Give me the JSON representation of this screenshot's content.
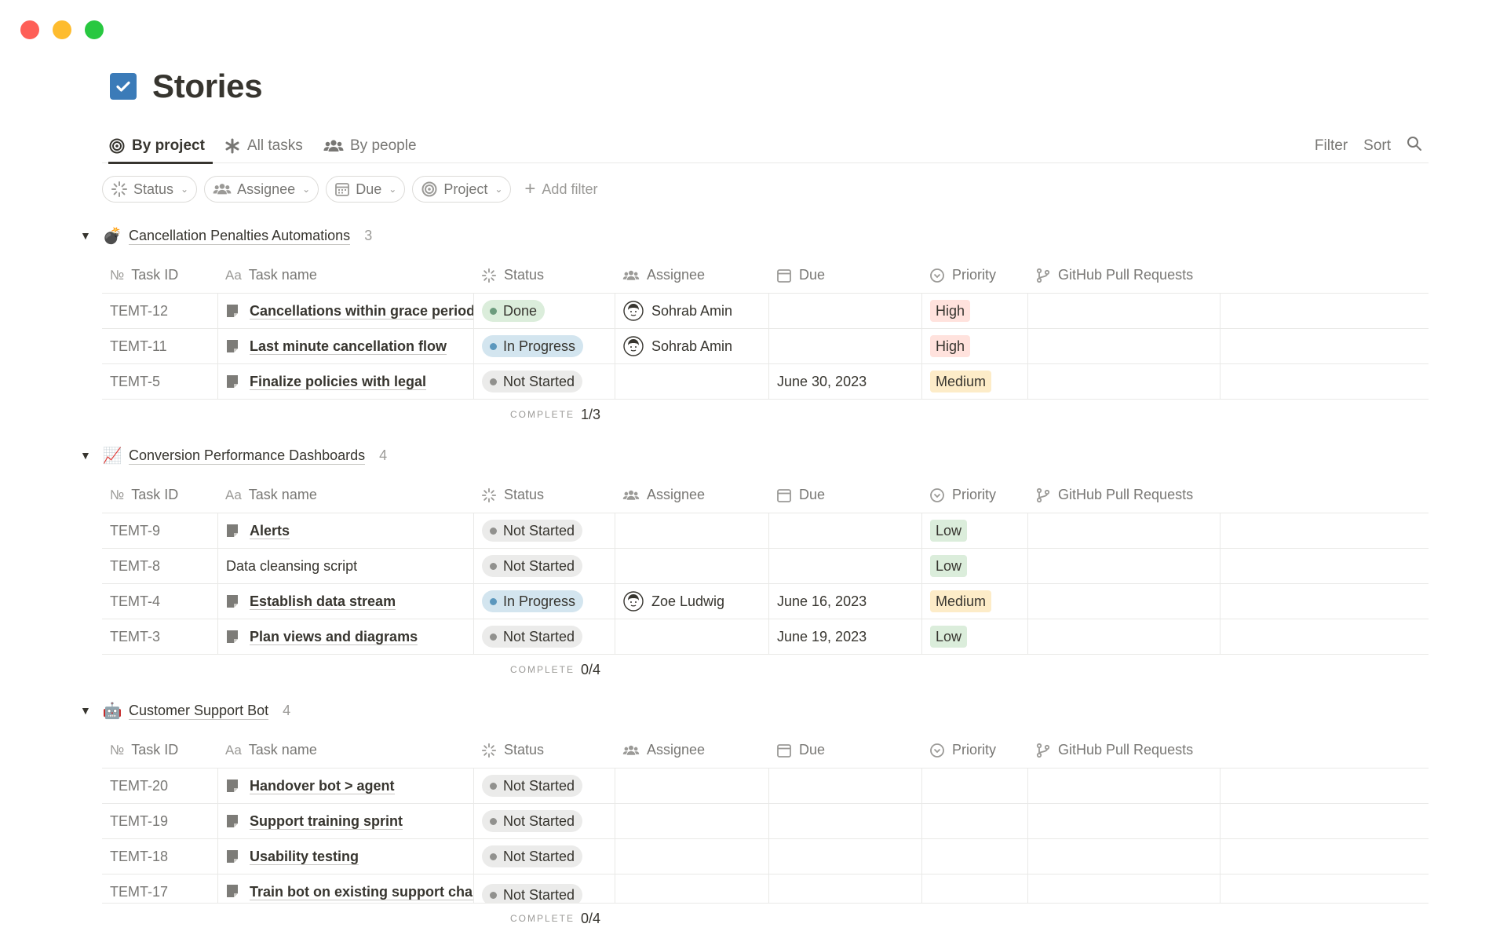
{
  "page": {
    "title": "Stories"
  },
  "tabs": [
    {
      "label": "By project",
      "icon": "target-icon",
      "active": true
    },
    {
      "label": "All tasks",
      "icon": "asterisk-icon",
      "active": false
    },
    {
      "label": "By people",
      "icon": "people-icon",
      "active": false
    }
  ],
  "actions": {
    "filter": "Filter",
    "sort": "Sort",
    "search_icon": "search-icon"
  },
  "filters": [
    {
      "label": "Status",
      "icon": "status-icon"
    },
    {
      "label": "Assignee",
      "icon": "people-icon"
    },
    {
      "label": "Due",
      "icon": "calendar-icon"
    },
    {
      "label": "Project",
      "icon": "target-icon"
    }
  ],
  "add_filter": "Add filter",
  "columns": {
    "task_id": "Task ID",
    "task_id_prefix": "№",
    "task_name": "Task name",
    "task_name_prefix": "Aa",
    "status": "Status",
    "assignee": "Assignee",
    "due": "Due",
    "priority": "Priority",
    "github": "GitHub Pull Requests"
  },
  "complete_label": "COMPLETE",
  "colors": {
    "done": "#dbeddb",
    "in_progress": "#d3e5ef",
    "not_started": "#ebebea",
    "high": "#ffe2dd",
    "medium": "#fdecc8",
    "low": "#dbeddb"
  },
  "groups": [
    {
      "emoji": "💣",
      "name": "Cancellation Penalties Automations",
      "count": "3",
      "complete": "1/3",
      "rows": [
        {
          "id": "TEMT-12",
          "name": "Cancellations within grace period",
          "status": "Done",
          "assignee": "Sohrab Amin",
          "due": "",
          "priority": "High"
        },
        {
          "id": "TEMT-11",
          "name": "Last minute cancellation flow",
          "status": "In Progress",
          "assignee": "Sohrab Amin",
          "due": "",
          "priority": "High"
        },
        {
          "id": "TEMT-5",
          "name": "Finalize policies with legal",
          "status": "Not Started",
          "assignee": "",
          "due": "June 30, 2023",
          "priority": "Medium"
        }
      ]
    },
    {
      "emoji": "📈",
      "name": "Conversion Performance Dashboards",
      "count": "4",
      "complete": "0/4",
      "rows": [
        {
          "id": "TEMT-9",
          "name": "Alerts",
          "status": "Not Started",
          "assignee": "",
          "due": "",
          "priority": "Low"
        },
        {
          "id": "TEMT-8",
          "name": "Data cleansing script",
          "status": "Not Started",
          "assignee": "",
          "due": "",
          "priority": "Low"
        },
        {
          "id": "TEMT-4",
          "name": "Establish data stream",
          "status": "In Progress",
          "assignee": "Zoe Ludwig",
          "due": "June 16, 2023",
          "priority": "Medium"
        },
        {
          "id": "TEMT-3",
          "name": "Plan views and diagrams",
          "status": "Not Started",
          "assignee": "",
          "due": "June 19, 2023",
          "priority": "Low"
        }
      ]
    },
    {
      "emoji": "🤖",
      "name": "Customer Support Bot",
      "count": "4",
      "complete": "0/4",
      "rows": [
        {
          "id": "TEMT-20",
          "name": "Handover bot > agent",
          "status": "Not Started",
          "assignee": "",
          "due": "",
          "priority": ""
        },
        {
          "id": "TEMT-19",
          "name": "Support training sprint",
          "status": "Not Started",
          "assignee": "",
          "due": "",
          "priority": ""
        },
        {
          "id": "TEMT-18",
          "name": "Usability testing",
          "status": "Not Started",
          "assignee": "",
          "due": "",
          "priority": ""
        },
        {
          "id": "TEMT-17",
          "name": "Train bot on existing support channels",
          "status": "Not Started",
          "assignee": "",
          "due": "",
          "priority": ""
        }
      ]
    }
  ]
}
